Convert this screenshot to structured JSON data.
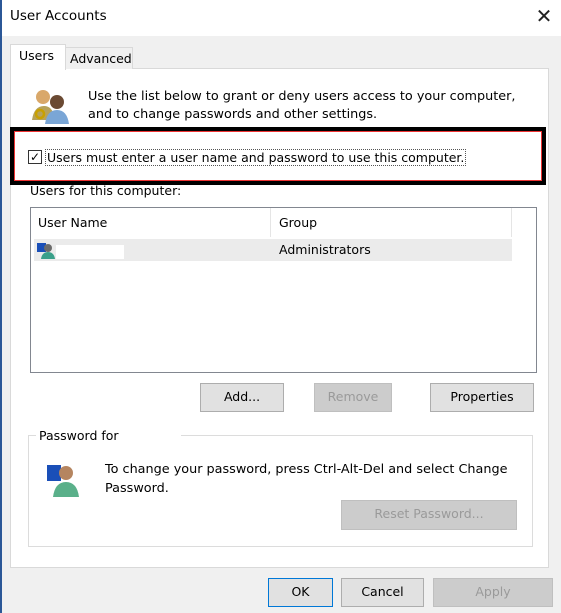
{
  "window": {
    "title": "User Accounts",
    "close_icon": "close-icon"
  },
  "tabs": [
    {
      "label": "Users",
      "selected": true
    },
    {
      "label": "Advanced",
      "selected": false
    }
  ],
  "intro": {
    "line1": "Use the list below to grant or deny users access to your computer,",
    "line2": "and to change passwords and other settings."
  },
  "require_login": {
    "label": "Users must enter a user name and password to use this computer.",
    "checked": true
  },
  "users_list": {
    "label": "Users for this computer:",
    "columns": [
      "User Name",
      "Group"
    ],
    "rows": [
      {
        "user_name": "",
        "group": "Administrators"
      }
    ]
  },
  "buttons": {
    "add": "Add...",
    "remove": "Remove",
    "properties": "Properties",
    "reset_password": "Reset Password...",
    "ok": "OK",
    "cancel": "Cancel",
    "apply": "Apply"
  },
  "password_group": {
    "legend": "Password for",
    "line1": "To change your password, press Ctrl-Alt-Del and select Change",
    "line2": "Password."
  },
  "colors": {
    "highlight_border": "#000000",
    "highlight_inner": "#e33333",
    "ok_border": "#0078d7"
  }
}
